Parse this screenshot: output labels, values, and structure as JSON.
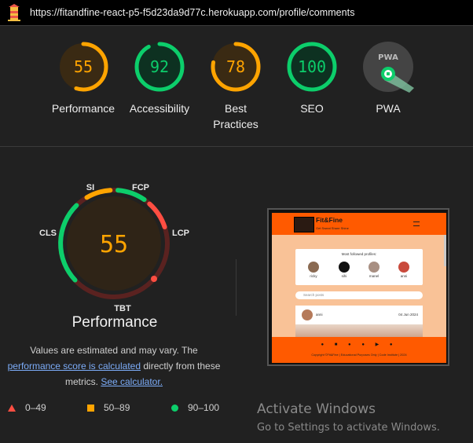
{
  "url": "https://fitandfine-react-p5-f5d23da9d77c.herokuapp.com/profile/comments",
  "colors": {
    "fail": "#ff4e42",
    "average": "#ffa400",
    "pass": "#0cce6b",
    "gray": "#9e9e9e"
  },
  "categories": [
    {
      "score": "55",
      "label": "Performance",
      "value": 55,
      "status": "average"
    },
    {
      "score": "92",
      "label": "Accessibility",
      "value": 92,
      "status": "pass"
    },
    {
      "score": "78",
      "label": "Best Practices",
      "value": 78,
      "status": "average"
    },
    {
      "score": "100",
      "label": "SEO",
      "value": 100,
      "status": "pass"
    },
    {
      "score": "",
      "label": "PWA",
      "value": 0,
      "status": "pwa",
      "badge": "PWA"
    }
  ],
  "performance": {
    "score": "55",
    "title": "Performance",
    "metrics": [
      "SI",
      "FCP",
      "LCP",
      "TBT",
      "CLS"
    ],
    "note_prefix": "Values are estimated and may vary. The",
    "note_link1": "performance score is calculated",
    "note_mid": "directly from these metrics.",
    "note_link2": "See calculator."
  },
  "legend": [
    {
      "shape": "triangle",
      "range": "0–49"
    },
    {
      "shape": "square",
      "range": "50–89"
    },
    {
      "shape": "circle",
      "range": "90–100"
    }
  ],
  "thumbnail": {
    "brand": "Fit&Fine",
    "tagline": "Get Sweat Share Shine",
    "card_title": "Most followed profiles:",
    "profiles": [
      "ricky",
      "sihi",
      "manel",
      "anni"
    ],
    "search_placeholder": "Search posts",
    "post_author": "anni",
    "post_date": "04 Jun 2024",
    "footer_copy": "Copyright ©Fit&Fine | Educational Purposes Only | Code Institute | 2024"
  },
  "watermark": {
    "title": "Activate Windows",
    "subtitle": "Go to Settings to activate Windows."
  }
}
